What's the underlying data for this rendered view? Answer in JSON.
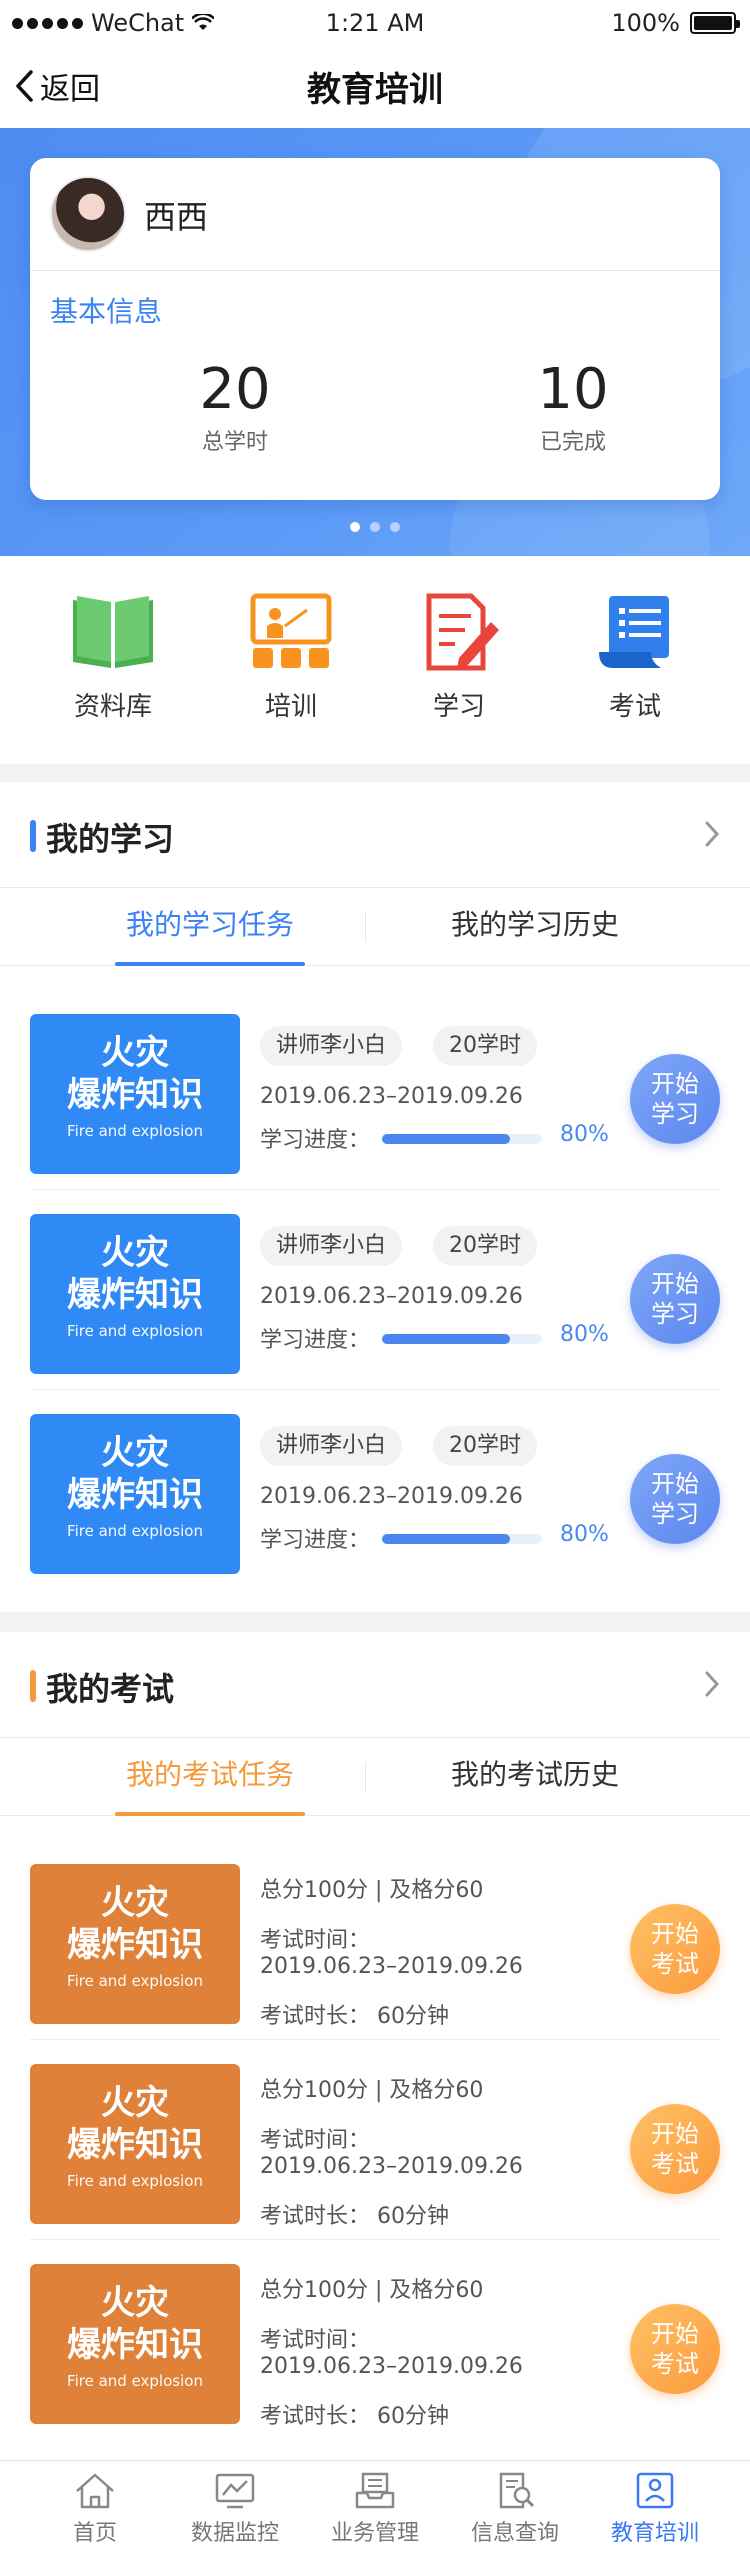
{
  "status_bar": {
    "carrier": "WeChat",
    "time": "1:21 AM",
    "battery": "100%"
  },
  "nav": {
    "back_label": "返回",
    "title": "教育培训"
  },
  "profile": {
    "name": "西西",
    "info_title": "基本信息",
    "stats": [
      {
        "value": "20",
        "label": "总学时"
      },
      {
        "value": "10",
        "label": "已完成"
      }
    ],
    "pager_count": 3,
    "pager_active": 0
  },
  "quick_menu": [
    {
      "label": "资料库",
      "icon": "book-icon"
    },
    {
      "label": "培训",
      "icon": "presentation-icon"
    },
    {
      "label": "学习",
      "icon": "notepad-pen-icon"
    },
    {
      "label": "考试",
      "icon": "scroll-icon"
    }
  ],
  "study": {
    "title": "我的学习",
    "tabs": [
      "我的学习任务",
      "我的学习历史"
    ],
    "items": [
      {
        "thumb_line1": "火灾",
        "thumb_line2": "爆炸知识",
        "thumb_en": "Fire and explosion",
        "teacher": "讲师李小白",
        "hours": "20学时",
        "date_range": "2019.06.23–2019.09.26",
        "progress_label": "学习进度：",
        "progress": 80,
        "progress_text": "80%",
        "action_line1": "开始",
        "action_line2": "学习"
      },
      {
        "thumb_line1": "火灾",
        "thumb_line2": "爆炸知识",
        "thumb_en": "Fire and explosion",
        "teacher": "讲师李小白",
        "hours": "20学时",
        "date_range": "2019.06.23–2019.09.26",
        "progress_label": "学习进度：",
        "progress": 80,
        "progress_text": "80%",
        "action_line1": "开始",
        "action_line2": "学习"
      },
      {
        "thumb_line1": "火灾",
        "thumb_line2": "爆炸知识",
        "thumb_en": "Fire and explosion",
        "teacher": "讲师李小白",
        "hours": "20学时",
        "date_range": "2019.06.23–2019.09.26",
        "progress_label": "学习进度：",
        "progress": 80,
        "progress_text": "80%",
        "action_line1": "开始",
        "action_line2": "学习"
      }
    ]
  },
  "exam": {
    "title": "我的考试",
    "tabs": [
      "我的考试任务",
      "我的考试历史"
    ],
    "items": [
      {
        "thumb_line1": "火灾",
        "thumb_line2": "爆炸知识",
        "thumb_en": "Fire and explosion",
        "score_info": "总分100分 | 及格分60",
        "time_label": "考试时间：",
        "date_range": "2019.06.23–2019.09.26",
        "duration": "考试时长：  60分钟",
        "action_line1": "开始",
        "action_line2": "考试"
      },
      {
        "thumb_line1": "火灾",
        "thumb_line2": "爆炸知识",
        "thumb_en": "Fire and explosion",
        "score_info": "总分100分 | 及格分60",
        "time_label": "考试时间：",
        "date_range": "2019.06.23–2019.09.26",
        "duration": "考试时长：  60分钟",
        "action_line1": "开始",
        "action_line2": "考试"
      },
      {
        "thumb_line1": "火灾",
        "thumb_line2": "爆炸知识",
        "thumb_en": "Fire and explosion",
        "score_info": "总分100分 | 及格分60",
        "time_label": "考试时间：",
        "date_range": "2019.06.23–2019.09.26",
        "duration": "考试时长：  60分钟",
        "action_line1": "开始",
        "action_line2": "考试"
      }
    ]
  },
  "tabbar": [
    {
      "label": "首页",
      "icon": "home-icon"
    },
    {
      "label": "数据监控",
      "icon": "monitor-chart-icon"
    },
    {
      "label": "业务管理",
      "icon": "inbox-tray-icon"
    },
    {
      "label": "信息查询",
      "icon": "document-search-icon"
    },
    {
      "label": "教育培训",
      "icon": "education-icon",
      "active": true
    }
  ],
  "colors": {
    "primary_blue": "#3b82f6",
    "accent_orange": "#f59a3c",
    "banner_blue": "#5c9bf7"
  }
}
